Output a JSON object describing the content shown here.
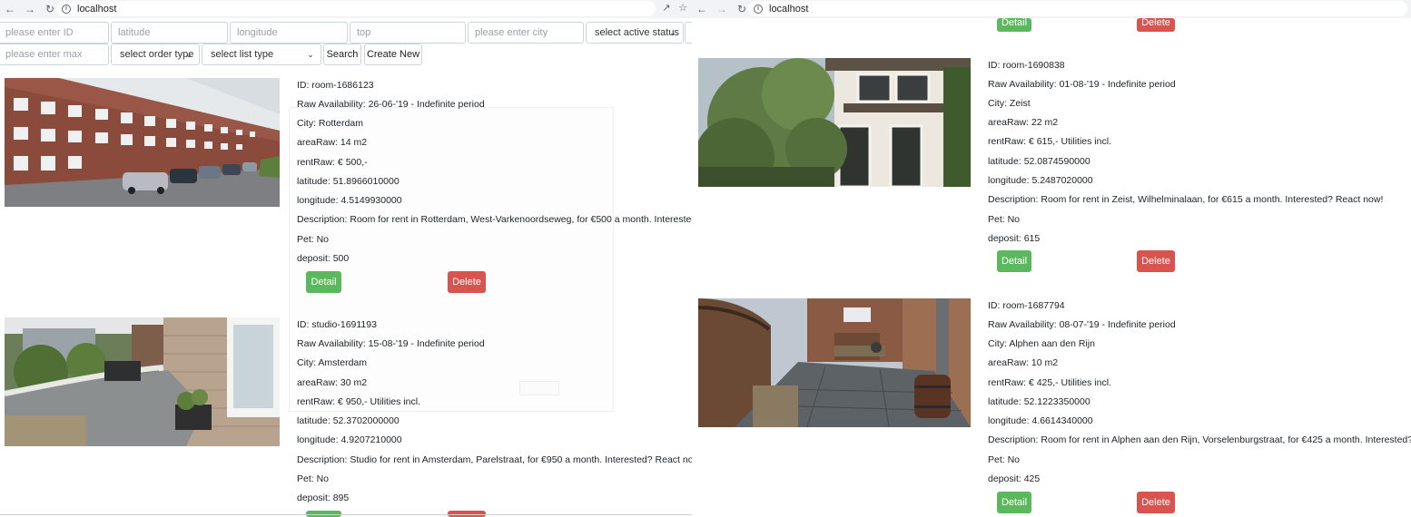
{
  "browser": {
    "left_url": "localhost",
    "right_url": "localhost"
  },
  "filters": {
    "id_placeholder": "please enter ID",
    "latitude_placeholder": "latitude",
    "longitude_placeholder": "longitude",
    "top_placeholder": "top",
    "city_placeholder": "please enter city",
    "active_status": "select active status",
    "max_placeholder": "please enter max",
    "order_type": "select order type",
    "list_type": "select list type",
    "search_label": "Search",
    "create_label": "Create New"
  },
  "labels": {
    "detail": "Detail",
    "delete": "Delete"
  },
  "listings_left": [
    {
      "id": "ID: room-1686123",
      "availability": "Raw Availability: 26-06-'19 - Indefinite period",
      "city": "City: Rotterdam",
      "area": "areaRaw: 14 m2",
      "rent": "rentRaw: € 500,-",
      "latitude": "latitude: 51.8966010000",
      "longitude": "longitude: 4.5149930000",
      "description": "Description: Room for rent in Rotterdam, West-Varkenoordseweg, for €500 a month. Interested? React now!",
      "pet": "Pet: No",
      "deposit": "deposit: 500"
    },
    {
      "id": "ID: studio-1691193",
      "availability": "Raw Availability: 15-08-'19 - Indefinite period",
      "city": "City: Amsterdam",
      "area": "areaRaw: 30 m2",
      "rent": "rentRaw: € 950,- Utilities incl.",
      "latitude": "latitude: 52.3702000000",
      "longitude": "longitude: 4.9207210000",
      "description": "Description: Studio for rent in Amsterdam, Parelstraat, for €950 a month. Interested? React now!",
      "pet": "Pet: No",
      "deposit": "deposit: 895"
    }
  ],
  "listings_right": [
    {
      "id": "ID: room-1690838",
      "availability": "Raw Availability: 01-08-'19 - Indefinite period",
      "city": "City: Zeist",
      "area": "areaRaw: 22 m2",
      "rent": "rentRaw: € 615,- Utilities incl.",
      "latitude": "latitude: 52.0874590000",
      "longitude": "longitude: 5.2487020000",
      "description": "Description: Room for rent in Zeist, Wilhelminalaan, for €615 a month. Interested? React now!",
      "pet": "Pet: No",
      "deposit": "deposit: 615"
    },
    {
      "id": "ID: room-1687794",
      "availability": "Raw Availability: 08-07-'19 - Indefinite period",
      "city": "City: Alphen aan den Rijn",
      "area": "areaRaw: 10 m2",
      "rent": "rentRaw: € 425,- Utilities incl.",
      "latitude": "latitude: 52.1223350000",
      "longitude": "longitude: 4.6614340000",
      "description": "Description: Room for rent in Alphen aan den Rijn, Vorselenburgstraat, for €425 a month. Interested? React now!",
      "pet": "Pet: No",
      "deposit": "deposit: 425"
    }
  ],
  "colors": {
    "detail_button": "#5cb85c",
    "delete_button": "#d9534f"
  }
}
